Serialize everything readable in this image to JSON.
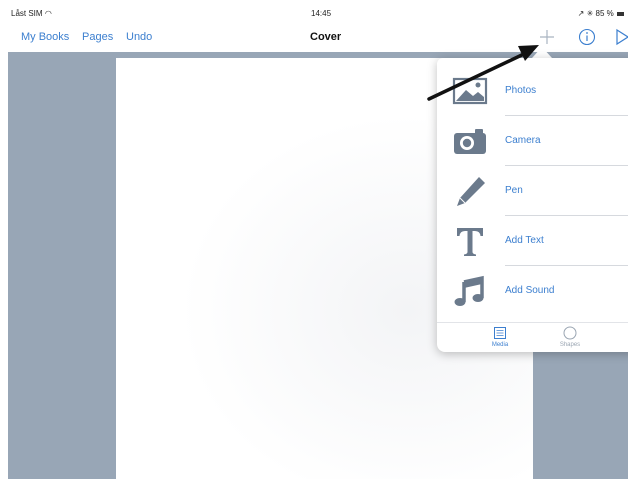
{
  "status_bar": {
    "carrier": "Låst SIM",
    "time": "14:45",
    "battery": "85 %"
  },
  "nav": {
    "my_books": "My Books",
    "pages": "Pages",
    "undo": "Undo",
    "title": "Cover"
  },
  "popover": {
    "items": [
      {
        "label": "Photos",
        "icon": "photo-icon"
      },
      {
        "label": "Camera",
        "icon": "camera-icon"
      },
      {
        "label": "Pen",
        "icon": "pen-icon"
      },
      {
        "label": "Add Text",
        "icon": "text-icon"
      },
      {
        "label": "Add Sound",
        "icon": "music-note-icon"
      }
    ],
    "tabs": [
      {
        "label": "Media",
        "icon": "media-icon"
      },
      {
        "label": "Shapes",
        "icon": "circle-icon"
      }
    ]
  },
  "colors": {
    "accent": "#3c7fcf",
    "workspace": "#98a6b6",
    "icon_gray": "#6b7a8c"
  }
}
